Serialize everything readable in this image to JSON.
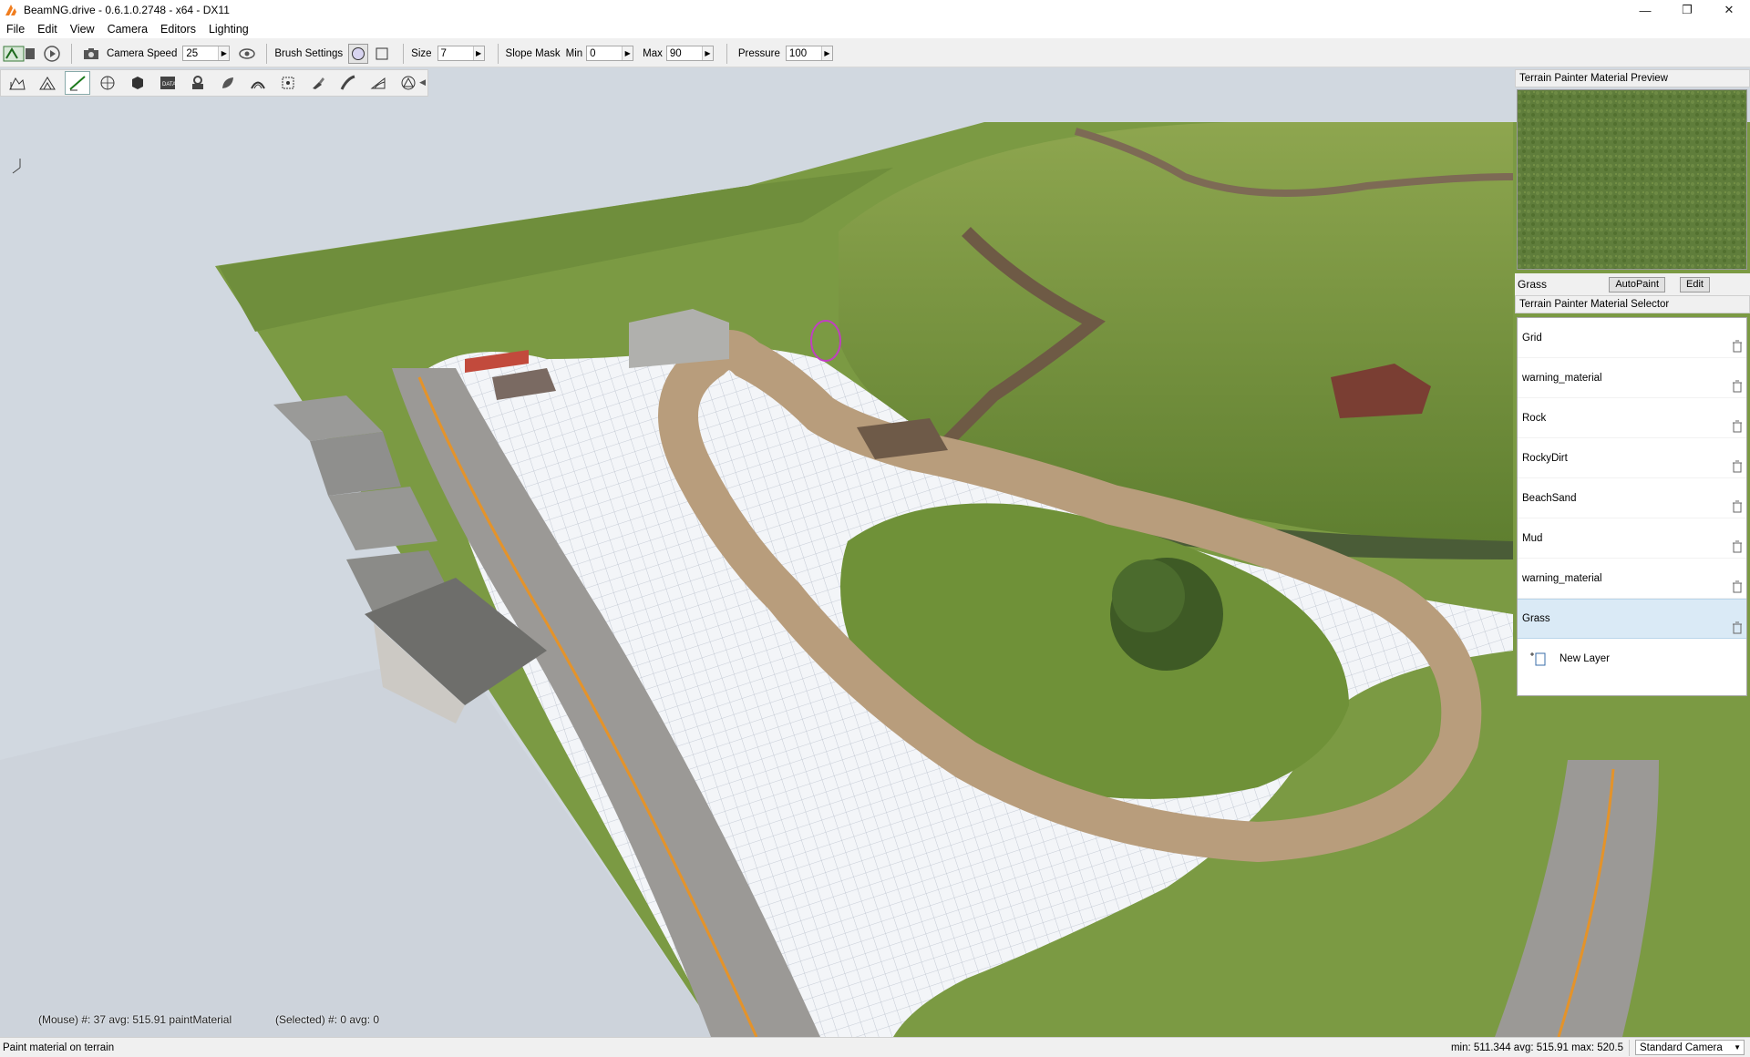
{
  "window": {
    "title": "BeamNG.drive - 0.6.1.0.2748 - x64 - DX11",
    "controls": [
      "—",
      "❐",
      "✕"
    ]
  },
  "menu": [
    "File",
    "Edit",
    "View",
    "Camera",
    "Editors",
    "Lighting"
  ],
  "toolbar": {
    "camera_speed_label": "Camera Speed",
    "camera_speed_value": "25",
    "brush_settings_label": "Brush Settings",
    "size_label": "Size",
    "size_value": "7",
    "slope_mask_label": "Slope Mask",
    "min_label": "Min",
    "min_value": "0",
    "max_label": "Max",
    "max_value": "90",
    "pressure_label": "Pressure",
    "pressure_value": "100"
  },
  "tools": [
    "terrain-select-icon",
    "raise-height-icon",
    "paint-material-icon",
    "smooth-icon",
    "flatten-icon",
    "noise-icon",
    "adjust-height-icon",
    "leaf-icon",
    "set-height-icon",
    "clear-icon",
    "paint-icon",
    "road-icon",
    "slope-icon",
    "mesh-icon"
  ],
  "preview": {
    "title": "Terrain Painter Material Preview",
    "material_name": "Grass",
    "autopaint_label": "AutoPaint",
    "edit_label": "Edit"
  },
  "selector": {
    "title": "Terrain Painter Material Selector",
    "materials": [
      "Grid",
      "warning_material",
      "Rock",
      "RockyDirt",
      "BeachSand",
      "Mud",
      "warning_material",
      "Grass"
    ],
    "selected": "Grass",
    "new_layer_label": "New Layer"
  },
  "viewport": {
    "mouse_info": "(Mouse) #: 37  avg: 515.91 paintMaterial",
    "selected_info": "(Selected) #: 0  avg: 0"
  },
  "status": {
    "message": "Paint material on terrain",
    "stats": "min: 511.344  avg: 515.91  max: 520.5",
    "camera": "Standard Camera"
  },
  "colors": {
    "sky": "#d0d7df",
    "grass": "#7b9a43",
    "grass_dark": "#56782d",
    "dirt": "#b59a7a",
    "road": "#9c9a97",
    "road_line": "#e89a2c",
    "grid": "#f2f4f7",
    "selection": "#daeaf6"
  }
}
